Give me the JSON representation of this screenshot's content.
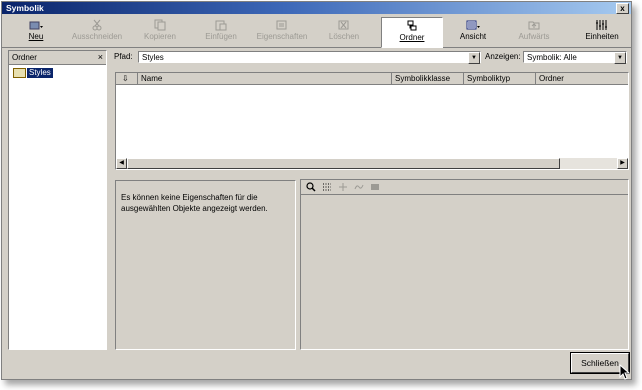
{
  "window": {
    "title": "Symbolik",
    "close_glyph": "x"
  },
  "toolbar": {
    "neu": "Neu",
    "ausschneiden": "Ausschneiden",
    "kopieren": "Kopieren",
    "einfuegen": "Einfügen",
    "eigenschaften": "Eigenschaften",
    "loeschen": "Löschen",
    "ordner": "Ordner",
    "ansicht": "Ansicht",
    "aufwaerts": "Aufwärts",
    "einheiten": "Einheiten"
  },
  "folder_pane": {
    "header": "Ordner",
    "close_glyph": "×",
    "items": [
      {
        "label": "Styles"
      }
    ]
  },
  "path": {
    "label": "Pfad:",
    "value": "Styles"
  },
  "show": {
    "label": "Anzeigen:",
    "value": "Symbolik: Alle"
  },
  "list": {
    "columns": [
      "Name",
      "Symbolikklasse",
      "Symboliktyp",
      "Ordner"
    ]
  },
  "properties": {
    "message": "Es können keine Eigenschaften für die ausgewählten Objekte angezeigt werden."
  },
  "footer": {
    "close_label": "Schließen"
  },
  "colors": {
    "title_start": "#0a246a",
    "title_end": "#a6caf0",
    "face": "#d4d0c8",
    "selection": "#0a246a"
  }
}
